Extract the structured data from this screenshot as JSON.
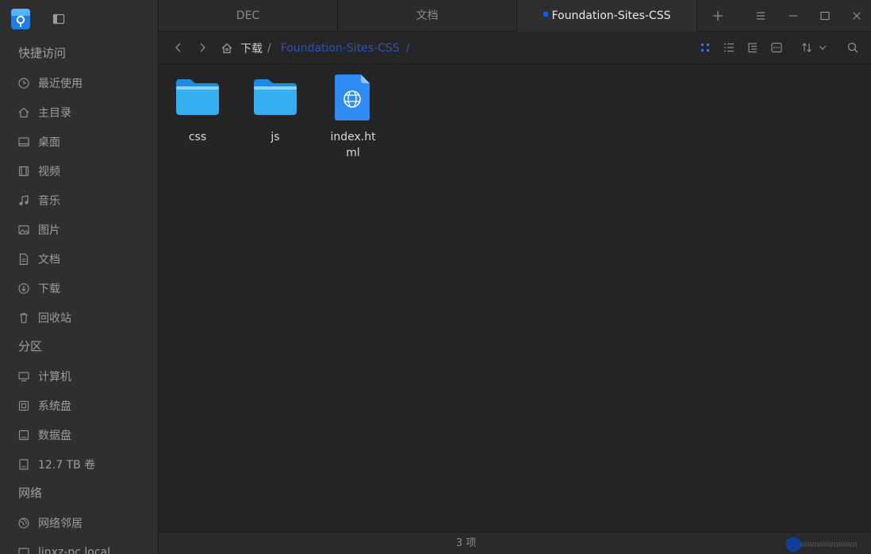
{
  "sidebar": {
    "groups": {
      "quick": "快捷访问",
      "partitions": "分区",
      "network": "网络"
    },
    "items": [
      {
        "label": "最近使用",
        "icon": "clock-icon"
      },
      {
        "label": "主目录",
        "icon": "home-icon"
      },
      {
        "label": "桌面",
        "icon": "desktop-icon"
      },
      {
        "label": "视频",
        "icon": "video-icon"
      },
      {
        "label": "音乐",
        "icon": "music-icon"
      },
      {
        "label": "图片",
        "icon": "picture-icon"
      },
      {
        "label": "文档",
        "icon": "document-icon"
      },
      {
        "label": "下载",
        "icon": "download-icon"
      },
      {
        "label": "回收站",
        "icon": "trash-icon"
      }
    ],
    "partitions": [
      {
        "label": "计算机",
        "icon": "computer-icon"
      },
      {
        "label": "系统盘",
        "icon": "disk-icon"
      },
      {
        "label": "数据盘",
        "icon": "disk-icon"
      },
      {
        "label": "12.7 TB 卷",
        "icon": "drive-icon"
      }
    ],
    "network": [
      {
        "label": "网络邻居",
        "icon": "network-icon"
      },
      {
        "label": "linxz-pc.local",
        "icon": "computer-icon"
      }
    ]
  },
  "tabs": [
    {
      "label": "DEC",
      "active": false
    },
    {
      "label": "文档",
      "active": false
    },
    {
      "label": "Foundation-Sites-CSS",
      "active": true
    }
  ],
  "breadcrumb": {
    "parent": "下载",
    "separator": "/",
    "current": "Foundation-Sites-CSS"
  },
  "files": [
    {
      "name": "css",
      "type": "folder"
    },
    {
      "name": "js",
      "type": "folder"
    },
    {
      "name": "index.html",
      "type": "html-file"
    }
  ],
  "status": {
    "count_text": "3 项"
  },
  "colors": {
    "accent": "#0a5cff",
    "breadcrumb_current": "#2a55b8",
    "folder_blue": "#2fa8ee"
  }
}
